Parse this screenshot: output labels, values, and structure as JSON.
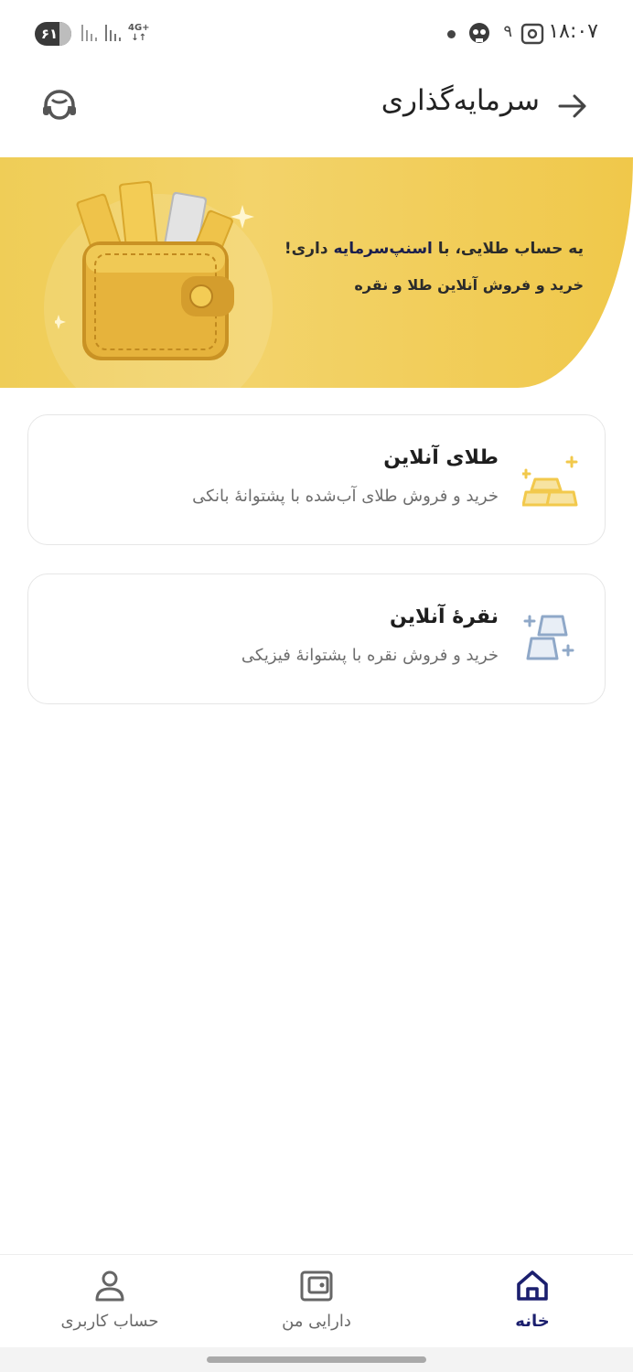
{
  "status_bar": {
    "battery": "۶۱",
    "network": "4G+",
    "notification_count": "۹",
    "time": "۱۸:۰۷"
  },
  "header": {
    "title": "سرمایه‌گذاری",
    "back_icon": "arrow-right-icon",
    "support_icon": "headset-support-icon"
  },
  "banner": {
    "line1_prefix": "یه حساب طلایی، با ",
    "line1_brand": "اسنپ‌سرمایه",
    "line1_suffix": " داری!",
    "line2": "خرید و فروش آنلاین طلا و نقره",
    "art": "gold-wallet-illustration"
  },
  "cards": [
    {
      "title": "طلای آنلاین",
      "subtitle": "خرید و فروش طلای آب‌شده با پشتوانهٔ بانکی",
      "icon": "gold-bars-icon",
      "icon_color": "#f2c94c"
    },
    {
      "title": "نقرهٔ آنلاین",
      "subtitle": "خرید و فروش نقره با پشتوانهٔ فیزیکی",
      "icon": "silver-bars-icon",
      "icon_color": "#8fa8c8"
    }
  ],
  "bottom_nav": {
    "items": [
      {
        "label": "خانه",
        "icon": "home-icon",
        "active": true
      },
      {
        "label": "دارایی من",
        "icon": "wallet-icon",
        "active": false
      },
      {
        "label": "حساب کاربری",
        "icon": "user-icon",
        "active": false
      }
    ]
  },
  "colors": {
    "banner_yellow": "#f1cf5c",
    "active_nav": "#1b1f6e",
    "card_border": "#e6e6e6"
  }
}
